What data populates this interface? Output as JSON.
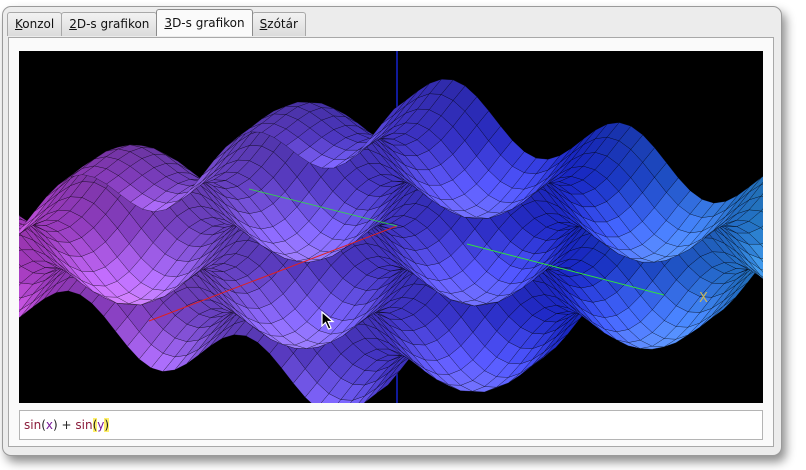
{
  "tabs": [
    {
      "mnemonic": "K",
      "rest": "onzol"
    },
    {
      "mnemonic": "2",
      "rest": "D-s grafikon"
    },
    {
      "mnemonic": "3",
      "rest": "D-s grafikon"
    },
    {
      "mnemonic": "S",
      "rest": "zótár"
    }
  ],
  "active_tab": 2,
  "plot": {
    "axis_x_label": "X",
    "background": "#000000",
    "axis_z_color": "#1a2cff",
    "axis_x_color": "#e02020",
    "axis_y_color": "#30e040",
    "surface_colors": [
      "#ff3bd9",
      "#7b4be0",
      "#1d2ee8",
      "#39e7e8"
    ]
  },
  "expression": {
    "fn1": "sin",
    "open1": "(",
    "var1": "x",
    "close1": ")",
    "op": "+",
    "fn2": "sin",
    "open2": "(",
    "var2": "y",
    "close2": ")"
  }
}
